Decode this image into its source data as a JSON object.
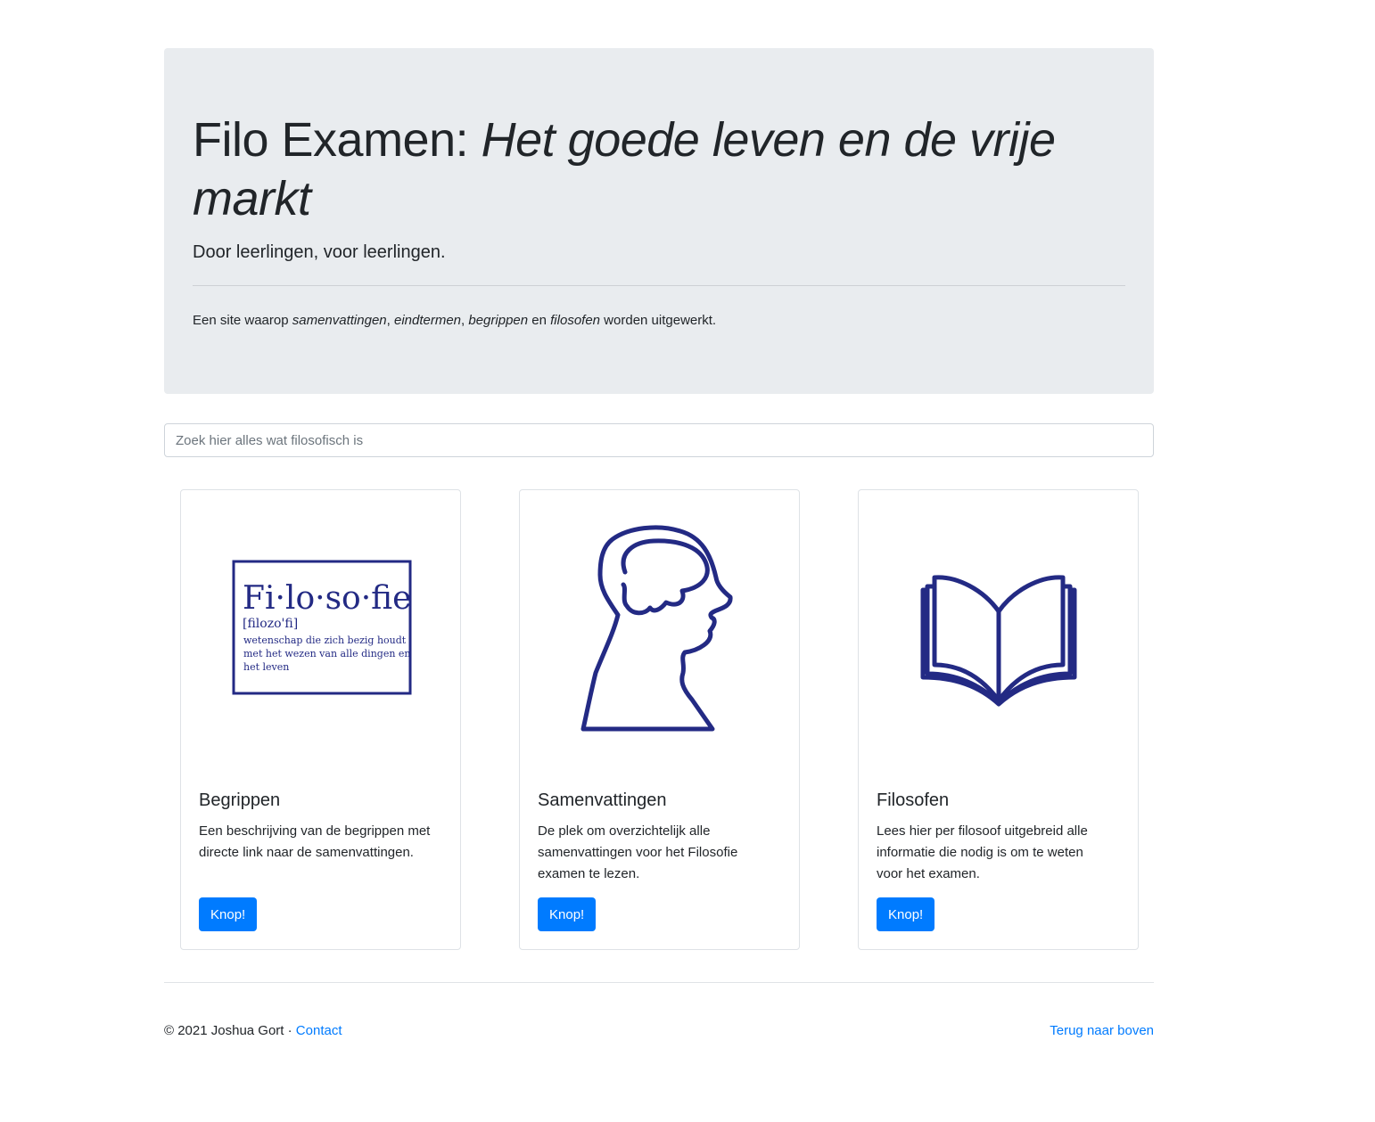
{
  "jumbotron": {
    "title_plain": "Filo Examen: ",
    "title_italic": "Het goede leven en de vrije markt",
    "lead": [
      "Door ",
      "leerlingen",
      ", voor ",
      "leerlingen",
      "."
    ],
    "intro": [
      "Een site waarop ",
      "samenvattingen",
      ", ",
      "eindtermen",
      ", ",
      "begrippen",
      " en ",
      "filosofen",
      " worden uitgewerkt."
    ]
  },
  "search": {
    "placeholder": "Zoek hier alles wat filosofisch is"
  },
  "cards": [
    {
      "title": "Begrippen",
      "text": "Een beschrijving van de begrippen met directe link naar de samenvattingen.",
      "button": "Knop!",
      "image": {
        "word": "Fi·lo·so·fie",
        "pron": "[filozo'fi]",
        "def": [
          "wetenschap die zich bezig houdt",
          "met het wezen van alle dingen en",
          "het leven"
        ]
      }
    },
    {
      "title": "Samenvattingen",
      "text": "De plek om overzichtelijk alle samenvattingen voor het Filosofie examen te lezen.",
      "button": "Knop!",
      "image": {
        "icon": "head-brain-icon"
      }
    },
    {
      "title": "Filosofen",
      "text": "Lees hier per filosoof uitgebreid alle informatie die nodig is om te weten voor het examen.",
      "button": "Knop!",
      "image": {
        "icon": "open-book-icon"
      }
    }
  ],
  "footer": {
    "copyright": "© 2021 Joshua Gort · ",
    "contact": "Contact",
    "back_to_top": "Terug naar boven"
  },
  "colors": {
    "accent": "#007bff",
    "jumbotron_bg": "#e9ecef",
    "illustration": "#232a84"
  }
}
